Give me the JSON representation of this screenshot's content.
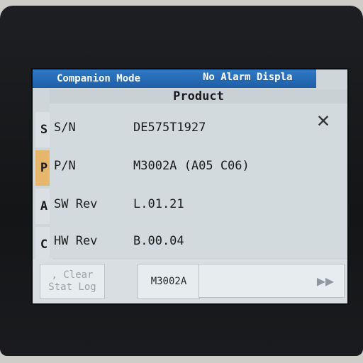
{
  "topbar": {
    "mode": "Companion Mode",
    "alarm": "No Alarm Displa"
  },
  "tabs": [
    "S",
    "P",
    "A",
    "C"
  ],
  "panel": {
    "title": "Product",
    "rows": [
      {
        "label": "S/N",
        "value": "DE575T1927"
      },
      {
        "label": "P/N",
        "value": "M3002A (A05 C06)"
      },
      {
        "label": "SW Rev",
        "value": "L.01.21"
      },
      {
        "label": "HW Rev",
        "value": "B.00.04"
      }
    ],
    "close_icon": "close-icon"
  },
  "bottombar": {
    "clear_line1": ", Clear",
    "clear_line2": "Stat Log",
    "model_button": "M3002A",
    "next_icon": "fast-forward-icon"
  }
}
